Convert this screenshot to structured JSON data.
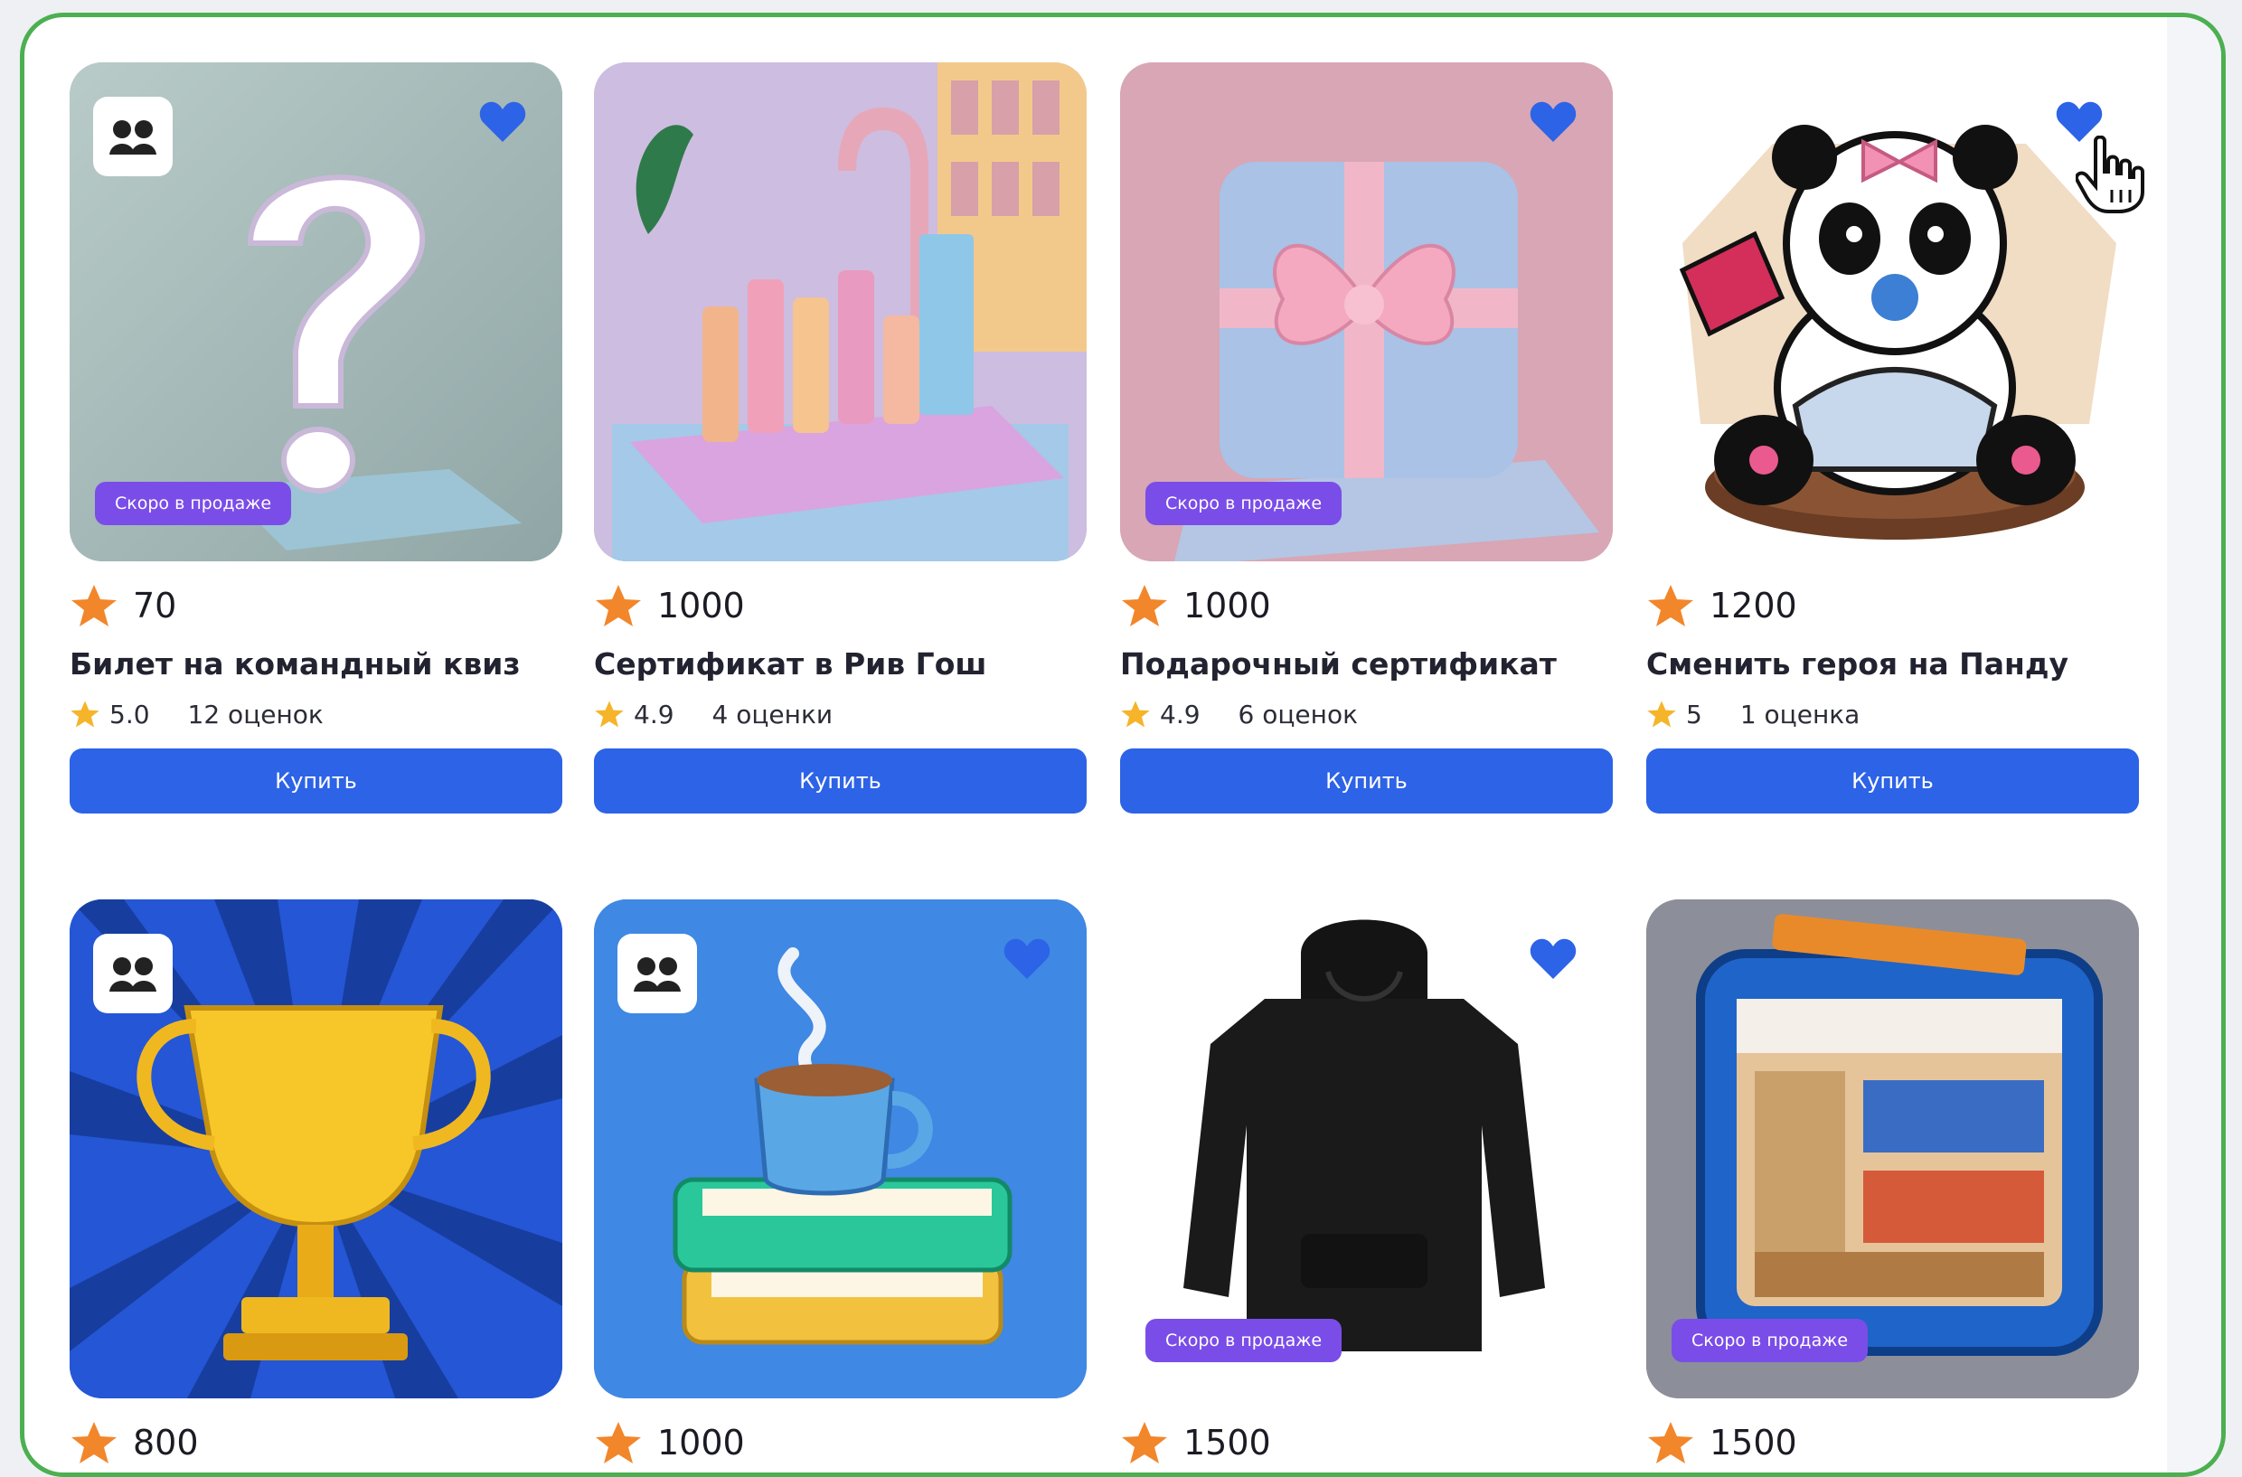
{
  "labels": {
    "soon": "Скоро в продаже",
    "buy": "Купить"
  },
  "colors": {
    "frame_border": "#4caf50",
    "buy_button": "#2d63e6",
    "soon_badge": "#7a4de8",
    "favorite_heart": "#2d63e6",
    "price_star": "#f2862a"
  },
  "products": [
    {
      "price": "70",
      "title": "Билет на командный квиз",
      "rating": "5.0",
      "reviews": "12 оценок",
      "image": "question-mark-image",
      "team_badge": true,
      "favorite": true,
      "soon": true
    },
    {
      "price": "1000",
      "title": "Сертификат в Рив Гош",
      "rating": "4.9",
      "reviews": "4 оценки",
      "image": "cosmetics-image",
      "team_badge": false,
      "favorite": false,
      "soon": false
    },
    {
      "price": "1000",
      "title": "Подарочный сертификат",
      "rating": "4.9",
      "reviews": "6 оценок",
      "image": "gift-box-image",
      "team_badge": false,
      "favorite": true,
      "soon": true
    },
    {
      "price": "1200",
      "title": "Сменить героя на Панду",
      "rating": "5",
      "reviews": "1 оценка",
      "image": "panda-image",
      "team_badge": false,
      "favorite": true,
      "soon": false
    },
    {
      "price": "800",
      "image": "trophy-image",
      "team_badge": true,
      "favorite": false,
      "soon": false
    },
    {
      "price": "1000",
      "image": "coffee-books-image",
      "team_badge": true,
      "favorite": true,
      "soon": false
    },
    {
      "price": "1500",
      "image": "hoodie-image",
      "team_badge": false,
      "favorite": true,
      "soon": true
    },
    {
      "price": "1500",
      "image": "store-image",
      "team_badge": false,
      "favorite": false,
      "soon": true
    }
  ]
}
